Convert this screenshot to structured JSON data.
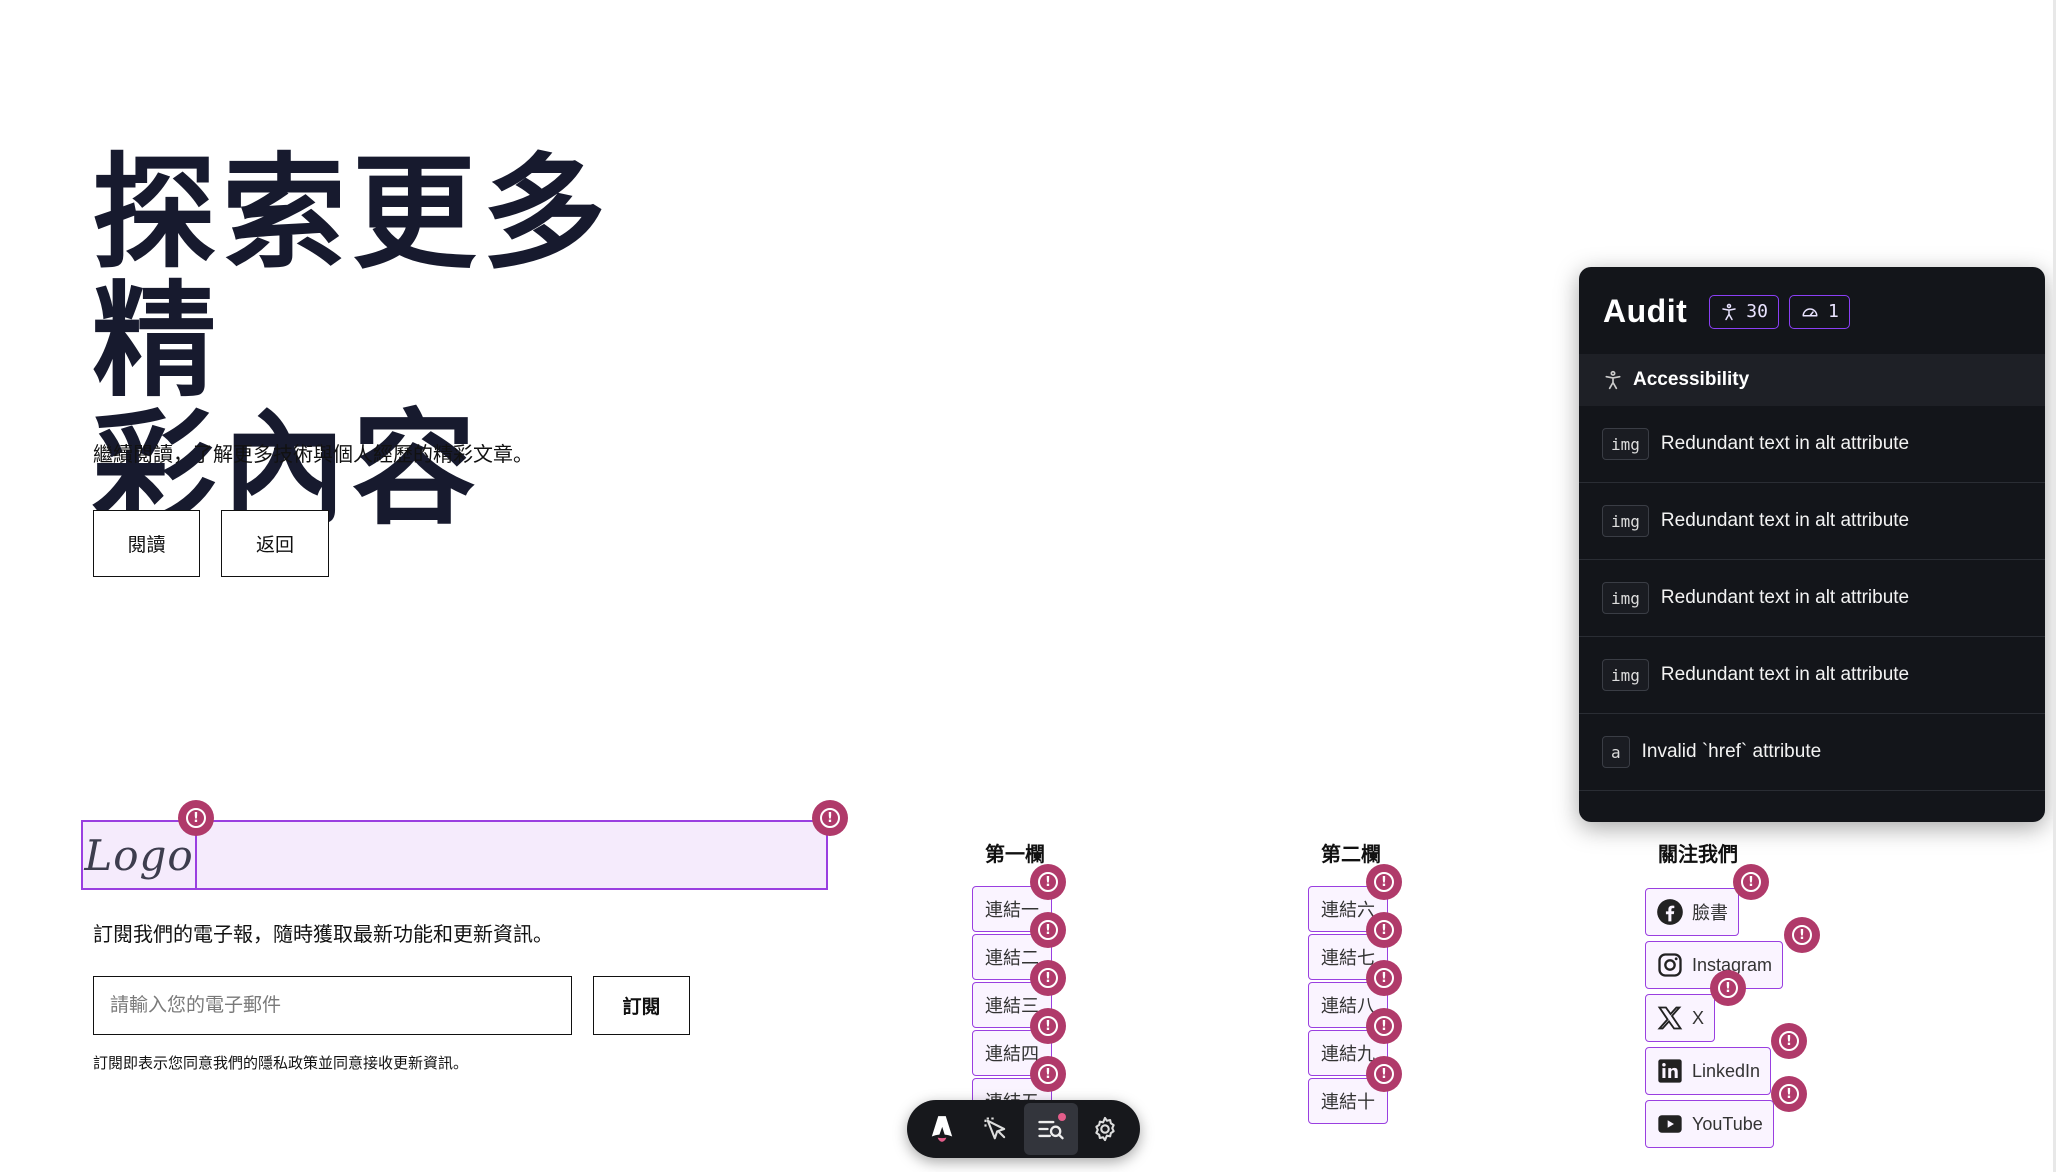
{
  "hero": {
    "title_line1": "探索更多精",
    "title_line2": "彩內容",
    "subtitle": "繼續閱讀，了解更多技術與個人經歷的精彩文章。",
    "read_button": "閱讀",
    "back_button": "返回"
  },
  "footer": {
    "logo_text": "Logo",
    "description": "訂閱我們的電子報，隨時獲取最新功能和更新資訊。",
    "email_placeholder": "請輸入您的電子郵件",
    "subscribe_button": "訂閱",
    "note": "訂閱即表示您同意我們的隱私政策並同意接收更新資訊。",
    "column1": {
      "heading": "第一欄",
      "links": [
        "連結一",
        "連結二",
        "連結三",
        "連結四",
        "連結五"
      ]
    },
    "column2": {
      "heading": "第二欄",
      "links": [
        "連結六",
        "連結七",
        "連結八",
        "連結九",
        "連結十"
      ]
    },
    "social": {
      "heading": "關注我們",
      "links": [
        {
          "label": "臉書",
          "icon": "facebook-icon"
        },
        {
          "label": "Instagram",
          "icon": "instagram-icon"
        },
        {
          "label": "X",
          "icon": "x-icon"
        },
        {
          "label": "LinkedIn",
          "icon": "linkedin-icon"
        },
        {
          "label": "YouTube",
          "icon": "youtube-icon"
        }
      ]
    }
  },
  "audit": {
    "title": "Audit",
    "accessibility_count": "30",
    "performance_count": "1",
    "category": "Accessibility",
    "items": [
      {
        "tag": "img",
        "message": "Redundant text in alt attribute"
      },
      {
        "tag": "img",
        "message": "Redundant text in alt attribute"
      },
      {
        "tag": "img",
        "message": "Redundant text in alt attribute"
      },
      {
        "tag": "img",
        "message": "Redundant text in alt attribute"
      },
      {
        "tag": "a",
        "message": "Invalid `href` attribute"
      }
    ]
  },
  "toolbar": {
    "items": [
      "astro-menu-icon",
      "inspect-icon",
      "audit-icon",
      "settings-icon"
    ],
    "active": "audit-icon"
  },
  "colors": {
    "highlight_border": "#9a3fe0",
    "highlight_fill": "#f5ebfc",
    "warning_badge": "#b03a6a",
    "panel_bg": "#13151a",
    "badge_border": "#8b3ff5"
  }
}
